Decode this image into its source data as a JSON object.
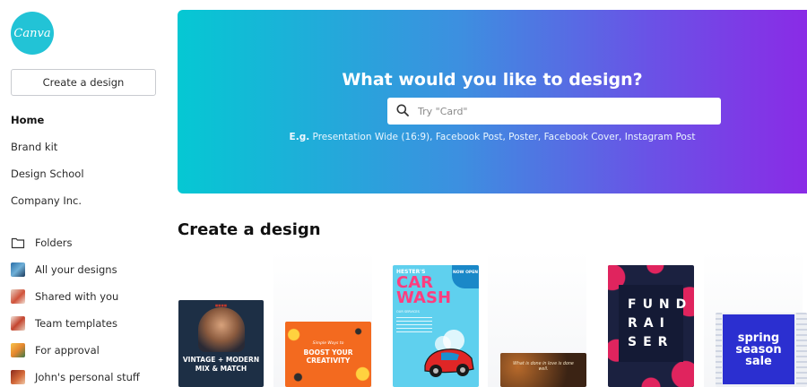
{
  "sidebar": {
    "logo_text": "Canva",
    "create_button": "Create a design",
    "nav": [
      "Home",
      "Brand kit",
      "Design School",
      "Company Inc."
    ],
    "folders": [
      {
        "label": "Folders",
        "icon": "folder-icon"
      },
      {
        "label": "All your designs",
        "icon": "designs-thumbnail-icon"
      },
      {
        "label": "Shared with you",
        "icon": "shared-thumbnail-icon"
      },
      {
        "label": "Team templates",
        "icon": "team-templates-thumbnail-icon"
      },
      {
        "label": "For approval",
        "icon": "approval-thumbnail-icon"
      },
      {
        "label": "John's personal stuff",
        "icon": "personal-thumbnail-icon"
      }
    ]
  },
  "hero": {
    "title": "What would you like to design?",
    "search_placeholder": "Try \"Card\"",
    "examples_prefix": "E.g.",
    "examples": [
      "Presentation Wide (16:9)",
      "Facebook Post",
      "Poster",
      "Facebook Cover",
      "Instagram Post"
    ]
  },
  "main": {
    "section_title": "Create a design",
    "cards": {
      "vintage": {
        "line1": "VINTAGE + MODERN",
        "line2": "MIX & MATCH"
      },
      "boost": {
        "line1": "BOOST YOUR",
        "line2": "CREATIVITY",
        "top": "Simple Ways to"
      },
      "carwash": {
        "title1": "HESTER'S",
        "title2": "CAR",
        "title3": "WASH",
        "badge": "NOW OPEN",
        "sub": "OUR SERVICES"
      },
      "quote": {
        "text": "What is done in love is done well."
      },
      "fundraiser": {
        "r1": "FUND",
        "r2": "RAI",
        "r3": "SER"
      },
      "spring": {
        "line1": "spring",
        "line2": "season",
        "line3": "sale"
      }
    }
  },
  "colors": {
    "logo": "#22c3d6",
    "hero_start": "#05c8d3",
    "hero_end": "#8a2be6"
  }
}
